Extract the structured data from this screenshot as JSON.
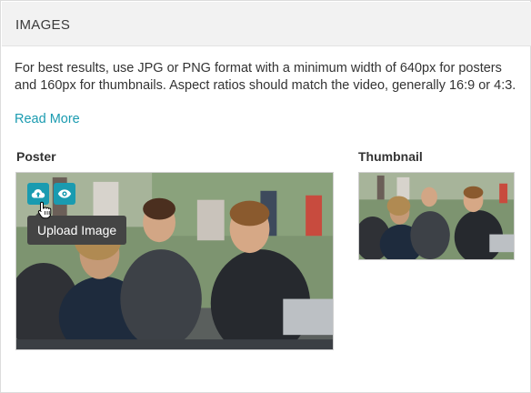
{
  "panel": {
    "title": "IMAGES"
  },
  "description": "For best results, use JPG or PNG format with a minimum width of 640px for posters and 160px for thumbnails. Aspect ratios should match the video, generally 16:9 or 4:3.",
  "read_more": "Read More",
  "poster": {
    "label": "Poster",
    "upload_icon": "cloud-upload-icon",
    "preview_icon": "eye-icon",
    "tooltip": "Upload Image"
  },
  "thumbnail": {
    "label": "Thumbnail"
  },
  "colors": {
    "accent": "#1a9bb0",
    "header_bg": "#f2f2f2",
    "tooltip_bg": "#444444"
  }
}
